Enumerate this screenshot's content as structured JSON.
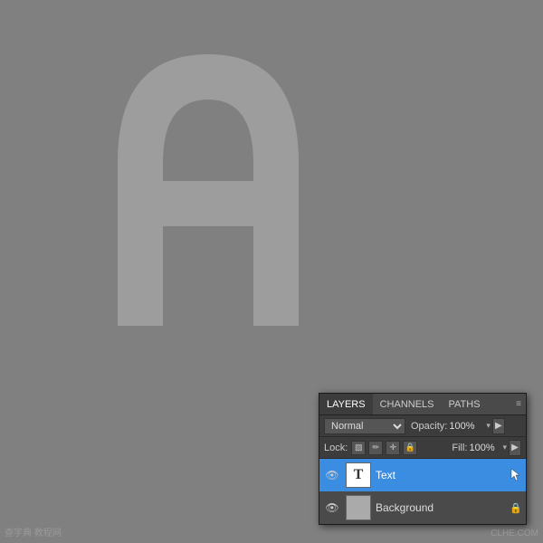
{
  "canvas": {
    "background_color": "#808080"
  },
  "panel": {
    "tabs": [
      {
        "label": "LAYERS",
        "active": true
      },
      {
        "label": "CHANNELS",
        "active": false
      },
      {
        "label": "PATHS",
        "active": false
      }
    ],
    "blend_mode": "Normal",
    "opacity_label": "Opacity:",
    "opacity_value": "100%",
    "lock_label": "Lock:",
    "fill_label": "Fill:",
    "fill_value": "100%",
    "layers": [
      {
        "name": "Text",
        "type": "text",
        "visible": true,
        "selected": true,
        "locked": false
      },
      {
        "name": "Background",
        "type": "image",
        "visible": true,
        "selected": false,
        "locked": true
      }
    ],
    "channels_label": "CHANNELS"
  },
  "watermark_left": "查字典 教程网",
  "watermark_right": "CLHE.COM"
}
